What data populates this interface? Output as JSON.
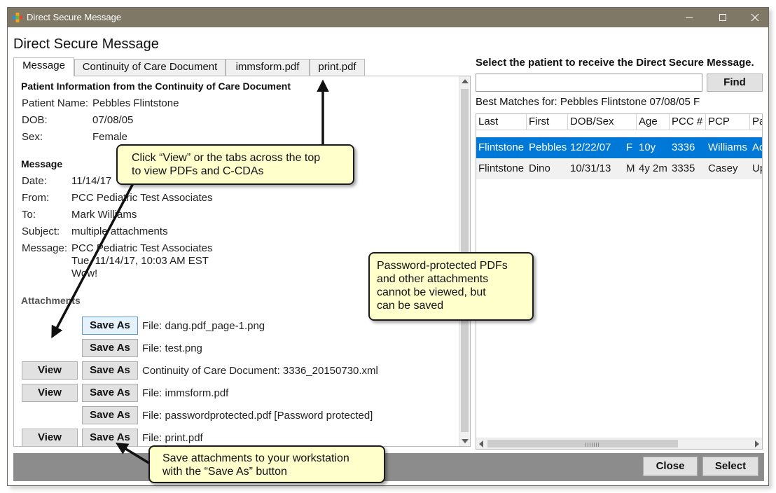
{
  "window": {
    "title": "Direct Secure Message",
    "heading": "Direct Secure Message"
  },
  "tabs": [
    {
      "label": "Message",
      "active": true
    },
    {
      "label": "Continuity of Care Document",
      "active": false
    },
    {
      "label": "immsform.pdf",
      "active": false
    },
    {
      "label": "print.pdf",
      "active": false
    }
  ],
  "patient_info": {
    "heading": "Patient Information from the Continuity of Care Document",
    "name_label": "Patient Name:",
    "name_value": "Pebbles Flintstone",
    "dob_label": "DOB:",
    "dob_value": "07/08/05",
    "sex_label": "Sex:",
    "sex_value": "Female"
  },
  "message": {
    "heading": "Message",
    "date_label": "Date:",
    "date_value": "11/14/17",
    "from_label": "From:",
    "from_value": "PCC Pediatric Test Associates",
    "to_label": "To:",
    "to_value": "Mark Williams",
    "subject_label": "Subject:",
    "subject_value": "multiple attachments",
    "message_label": "Message:",
    "body_lines": [
      "PCC Pediatric Test Associates",
      "Tue, 11/14/17, 10:03 AM EST",
      "Wow!"
    ]
  },
  "attachments": {
    "heading": "Attachments",
    "view_label": "View",
    "save_as_label": "Save As",
    "items": [
      {
        "label": "File: dang.pdf_page-1.png",
        "has_view": false
      },
      {
        "label": "File: test.png",
        "has_view": false
      },
      {
        "label": "Continuity of Care Document: 3336_20150730.xml",
        "has_view": true
      },
      {
        "label": "File: immsform.pdf",
        "has_view": true
      },
      {
        "label": "File: passwordprotected.pdf [Password protected]",
        "has_view": false
      },
      {
        "label": "File: print.pdf",
        "has_view": true
      }
    ]
  },
  "patient_search": {
    "label": "Select the patient to receive the Direct Secure Message.",
    "input_value": "",
    "find_label": "Find",
    "best_matches": "Best Matches for: Pebbles Flintstone 07/08/05 F"
  },
  "results": {
    "columns": [
      "Last",
      "First",
      "DOB/Sex",
      "Age",
      "PCC #",
      "PCP",
      "Pa"
    ],
    "rows": [
      {
        "last": "Flintstone",
        "first": "Pebbles",
        "dob": "12/22/07",
        "sex": "F",
        "age": "10y",
        "pcc": "3336",
        "pcp": "Williams",
        "pa": "Ac",
        "selected": true
      },
      {
        "last": "Flintstone",
        "first": "Dino",
        "dob": "10/31/13",
        "sex": "M",
        "age": "4y 2m",
        "pcc": "3335",
        "pcp": "Casey",
        "pa": "Up",
        "selected": false
      }
    ]
  },
  "footer": {
    "close_label": "Close",
    "select_label": "Select"
  },
  "callouts": {
    "view_tabs": [
      "Click “View” or the tabs across the top",
      "to view PDFs and C-CDAs"
    ],
    "password": [
      "Password-protected PDFs",
      "and other attachments",
      "cannot be viewed, but",
      "can be saved"
    ],
    "save_as": [
      "Save attachments to your workstation",
      "with the “Save As” button"
    ]
  },
  "colors": {
    "titlebar": "#7f7866",
    "selection": "#0078d7",
    "callout_fill": "#ffffcc",
    "footer_bar": "#8c8c8c"
  }
}
